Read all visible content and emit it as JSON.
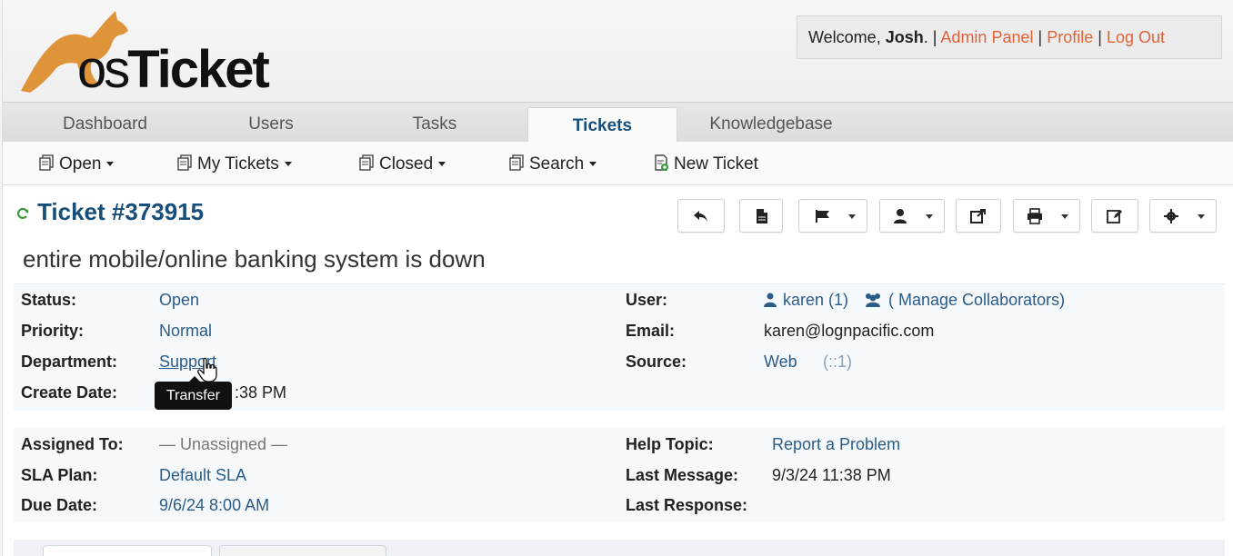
{
  "header": {
    "logo": {
      "part1": "os",
      "part2": "Ticket"
    },
    "welcome": {
      "prefix": "Welcome, ",
      "user": "Josh",
      "suffix": ". |",
      "links": [
        "Admin Panel",
        "Profile",
        "Log Out"
      ],
      "sep": "|"
    }
  },
  "nav": {
    "tabs": [
      {
        "label": "Dashboard"
      },
      {
        "label": "Users"
      },
      {
        "label": "Tasks"
      },
      {
        "label": "Tickets",
        "active": true
      },
      {
        "label": "Knowledgebase"
      }
    ]
  },
  "subnav": {
    "items": [
      {
        "label": "Open",
        "icon": "tickets-icon",
        "dropdown": true
      },
      {
        "label": "My Tickets",
        "icon": "tickets-icon",
        "dropdown": true
      },
      {
        "label": "Closed",
        "icon": "tickets-icon",
        "dropdown": true
      },
      {
        "label": "Search",
        "icon": "tickets-icon",
        "dropdown": true
      },
      {
        "label": "New Ticket",
        "icon": "new-ticket-icon",
        "dropdown": false
      }
    ]
  },
  "ticket": {
    "title": "Ticket #373915",
    "subject": "entire mobile/online banking system is down"
  },
  "info": {
    "status": {
      "label": "Status:",
      "value": "Open"
    },
    "priority": {
      "label": "Priority:",
      "value": "Normal"
    },
    "department": {
      "label": "Department:",
      "value": "Support"
    },
    "create_date": {
      "label": "Create Date:",
      "value": ":38 PM"
    },
    "user": {
      "label": "User:",
      "value": "karen (1)",
      "collab": "( Manage Collaborators)"
    },
    "email": {
      "label": "Email:",
      "value": "karen@lognpacific.com"
    },
    "source": {
      "label": "Source:",
      "value": "Web",
      "extra": "(::1)"
    },
    "assigned_to": {
      "label": "Assigned To:",
      "value": "— Unassigned —"
    },
    "sla_plan": {
      "label": "SLA Plan:",
      "value": "Default SLA"
    },
    "due_date": {
      "label": "Due Date:",
      "value": "9/6/24 8:00 AM"
    },
    "help_topic": {
      "label": "Help Topic:",
      "value": "Report a Problem"
    },
    "last_message": {
      "label": "Last Message:",
      "value": "9/3/24 11:38 PM"
    },
    "last_response": {
      "label": "Last Response:",
      "value": ""
    }
  },
  "tooltip": "Transfer",
  "colors": {
    "brand_orange": "#e0633a",
    "link_blue": "#2b5b86",
    "title_blue": "#184e7a",
    "refresh_green": "#3a9a3a"
  }
}
